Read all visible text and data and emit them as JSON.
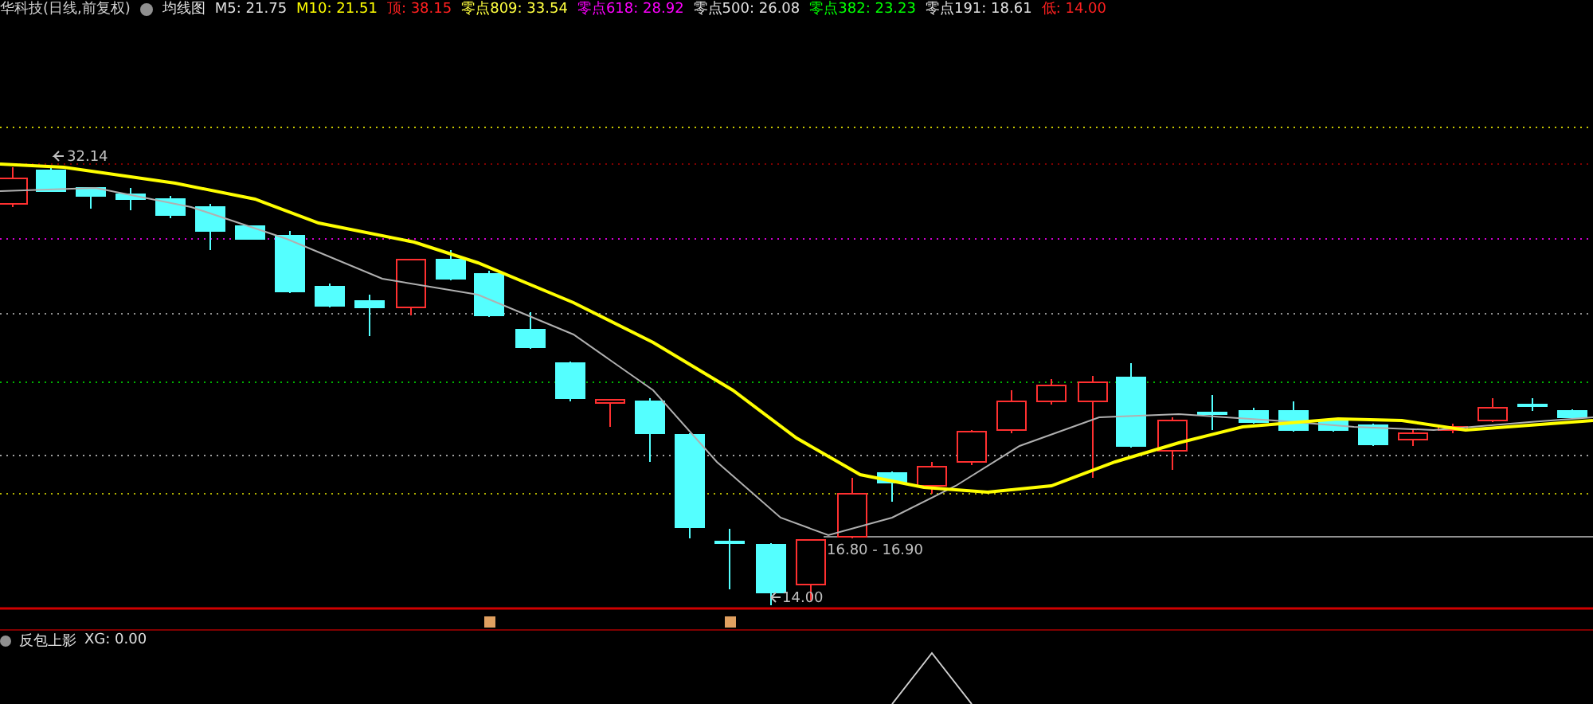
{
  "header": {
    "title": "华科技(日线,前复权)",
    "indicator": "均线图",
    "legend": [
      {
        "text": "M5: 21.75",
        "color": "#e0e0e0"
      },
      {
        "text": "M10: 21.51",
        "color": "#ffff00"
      },
      {
        "text": "顶: 38.15",
        "color": "#ff2020"
      },
      {
        "text": "零点809: 33.54",
        "color": "#ffff40"
      },
      {
        "text": "零点618: 28.92",
        "color": "#ff00ff"
      },
      {
        "text": "零点500: 26.08",
        "color": "#e0e0e0"
      },
      {
        "text": "零点382: 23.23",
        "color": "#00ff00"
      },
      {
        "text": "零点191: 18.61",
        "color": "#e0e0e0"
      },
      {
        "text": "低: 14.00",
        "color": "#ff2020"
      }
    ]
  },
  "chart": {
    "high_label": "32.14",
    "range_label": "16.80 - 16.90",
    "low_label": "14.00"
  },
  "sub_panel": {
    "name": "反包上影",
    "reading": "XG: 0.00"
  }
}
